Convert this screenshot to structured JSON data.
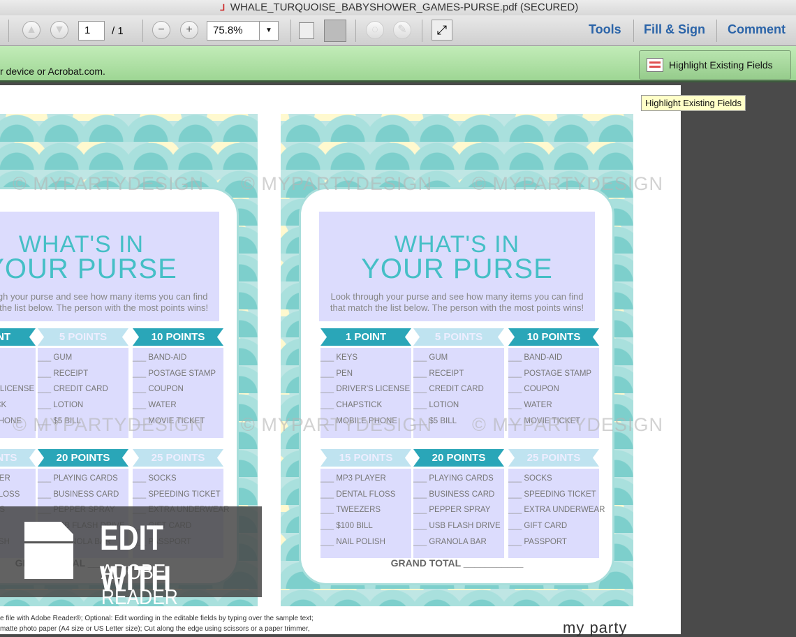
{
  "window": {
    "title": "WHALE_TURQUOISE_BABYSHOWER_GAMES-PURSE.pdf (SECURED)"
  },
  "toolbar": {
    "page_current": "1",
    "page_total": "/ 1",
    "zoom": "75.8%",
    "links": [
      "Tools",
      "Fill & Sign",
      "Comment"
    ]
  },
  "notice": {
    "message": "r device or Acrobat.com.",
    "highlight_button": "Highlight Existing Fields",
    "tooltip": "Highlight Existing Fields"
  },
  "card": {
    "title1": "WHAT'S IN",
    "title2": "YOUR PURSE",
    "desc1": "Look through your purse and see how many items you can find",
    "desc2": "that match the list below. The person with the most points wins!",
    "groups": [
      {
        "label": "1 POINT",
        "style": "dark",
        "items": [
          "KEYS",
          "PEN",
          "DRIVER'S LICENSE",
          "CHAPSTICK",
          "MOBILE PHONE"
        ]
      },
      {
        "label": "5 POINTS",
        "style": "light",
        "items": [
          "GUM",
          "RECEIPT",
          "CREDIT CARD",
          "LOTION",
          "$5 BILL"
        ]
      },
      {
        "label": "10 POINTS",
        "style": "dark",
        "items": [
          "BAND-AID",
          "POSTAGE STAMP",
          "COUPON",
          "WATER",
          "MOVIE TICKET"
        ]
      },
      {
        "label": "15 POINTS",
        "style": "light",
        "items": [
          "MP3 PLAYER",
          "DENTAL FLOSS",
          "TWEEZERS",
          "$100 BILL",
          "NAIL POLISH"
        ]
      },
      {
        "label": "20 POINTS",
        "style": "dark",
        "items": [
          "PLAYING CARDS",
          "BUSINESS CARD",
          "PEPPER SPRAY",
          "USB FLASH DRIVE",
          "GRANOLA BAR"
        ]
      },
      {
        "label": "25 POINTS",
        "style": "light",
        "items": [
          "SOCKS",
          "SPEEDING TICKET",
          "EXTRA UNDERWEAR",
          "GIFT CARD",
          "PASSPORT"
        ]
      }
    ],
    "grand_total": "GRAND TOTAL ___________"
  },
  "watermark": "© MYPARTYDESIGN",
  "overlay": {
    "line1": "EDIT WITH",
    "line2": "ADOBE READER"
  },
  "footer": {
    "line1": "e file with Adobe Reader®; Optional: Edit wording in the editable fields by typing over the sample text;",
    "line2": " matte photo paper (A4 size or US Letter size); Cut along the edge using scissors or a paper trimmer,",
    "logo": "my party"
  }
}
